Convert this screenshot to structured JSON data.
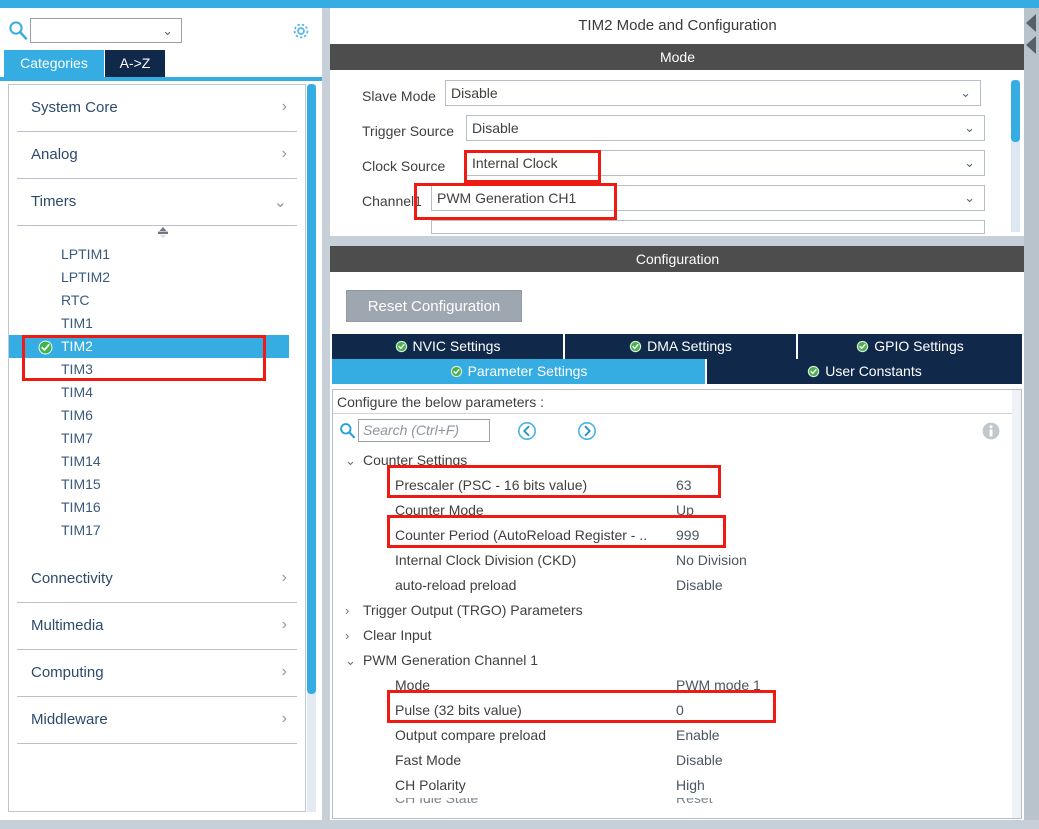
{
  "app": {
    "accent_blue": "#35ace2",
    "navy": "#10294a",
    "dark_bar": "#4d4d4d",
    "annotation_red": "#ee1b12"
  },
  "sidebar": {
    "search": {
      "value": "",
      "placeholder": "",
      "icon": "search-icon"
    },
    "gear_icon": "gear-icon",
    "tabs": [
      {
        "label": "Categories",
        "active": true
      },
      {
        "label": "A->Z",
        "active": false
      }
    ],
    "categories": [
      {
        "label": "System Core",
        "expanded": false
      },
      {
        "label": "Analog",
        "expanded": false
      },
      {
        "label": "Timers",
        "expanded": true
      }
    ],
    "timers": [
      {
        "label": "LPTIM1",
        "selected": false,
        "configured": false
      },
      {
        "label": "LPTIM2",
        "selected": false,
        "configured": false
      },
      {
        "label": "RTC",
        "selected": false,
        "configured": false
      },
      {
        "label": "TIM1",
        "selected": false,
        "configured": false
      },
      {
        "label": "TIM2",
        "selected": true,
        "configured": true
      },
      {
        "label": "TIM3",
        "selected": false,
        "configured": false
      },
      {
        "label": "TIM4",
        "selected": false,
        "configured": false
      },
      {
        "label": "TIM6",
        "selected": false,
        "configured": false
      },
      {
        "label": "TIM7",
        "selected": false,
        "configured": false
      },
      {
        "label": "TIM14",
        "selected": false,
        "configured": false
      },
      {
        "label": "TIM15",
        "selected": false,
        "configured": false
      },
      {
        "label": "TIM16",
        "selected": false,
        "configured": false
      },
      {
        "label": "TIM17",
        "selected": false,
        "configured": false
      }
    ],
    "categories_bottom": [
      {
        "label": "Connectivity",
        "expanded": false
      },
      {
        "label": "Multimedia",
        "expanded": false
      },
      {
        "label": "Computing",
        "expanded": false
      },
      {
        "label": "Middleware",
        "expanded": false
      }
    ]
  },
  "main": {
    "title": "TIM2 Mode and Configuration",
    "mode_section_title": "Mode",
    "mode_rows": [
      {
        "label": "Slave Mode",
        "value": "Disable"
      },
      {
        "label": "Trigger Source",
        "value": "Disable"
      },
      {
        "label": "Clock Source",
        "value": "Internal Clock"
      },
      {
        "label": "Channel1",
        "value": "PWM Generation CH1"
      }
    ],
    "configuration_section_title": "Configuration",
    "reset_button": "Reset Configuration",
    "tabs_top": [
      {
        "label": "NVIC Settings",
        "active": false
      },
      {
        "label": "DMA Settings",
        "active": false
      },
      {
        "label": "GPIO Settings",
        "active": false
      }
    ],
    "tabs_bottom": [
      {
        "label": "Parameter Settings",
        "active": true
      },
      {
        "label": "User Constants",
        "active": false
      }
    ],
    "param_header": "Configure the below parameters :",
    "toolbar": {
      "search_placeholder": "Search (Ctrl+F)",
      "search_value": "",
      "prev_icon": "previous-icon",
      "next_icon": "next-icon",
      "info_icon": "info-icon"
    },
    "groups": [
      {
        "label": "Counter Settings",
        "expanded": true,
        "rows": [
          {
            "name": "Prescaler (PSC - 16 bits value)",
            "value": "63",
            "highlighted": true
          },
          {
            "name": "Counter Mode",
            "value": "Up",
            "highlighted": false
          },
          {
            "name": "Counter Period (AutoReload Register - ..",
            "value": "999",
            "highlighted": true
          },
          {
            "name": "Internal Clock Division (CKD)",
            "value": "No Division",
            "highlighted": false
          },
          {
            "name": "auto-reload preload",
            "value": "Disable",
            "highlighted": false
          }
        ]
      },
      {
        "label": "Trigger Output (TRGO) Parameters",
        "expanded": false,
        "rows": []
      },
      {
        "label": "Clear Input",
        "expanded": false,
        "rows": []
      },
      {
        "label": "PWM Generation Channel 1",
        "expanded": true,
        "rows": [
          {
            "name": "Mode",
            "value": "PWM mode 1",
            "highlighted": false
          },
          {
            "name": "Pulse (32 bits value)",
            "value": "0",
            "highlighted": true
          },
          {
            "name": "Output compare preload",
            "value": "Enable",
            "highlighted": false
          },
          {
            "name": "Fast Mode",
            "value": "Disable",
            "highlighted": false
          },
          {
            "name": "CH Polarity",
            "value": "High",
            "highlighted": false
          }
        ]
      }
    ]
  }
}
